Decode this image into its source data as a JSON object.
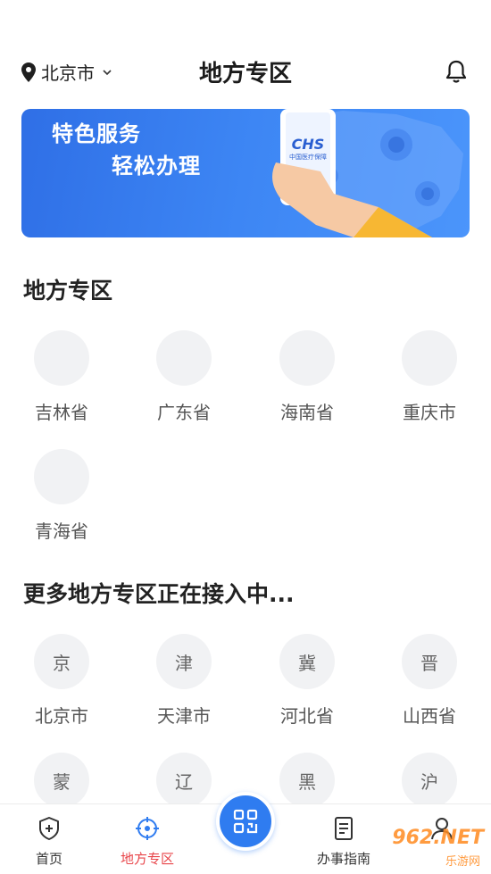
{
  "header": {
    "location": "北京市",
    "title": "地方专区"
  },
  "banner": {
    "line1": "特色服务",
    "line2": "轻松办理",
    "logo_text": "CHS",
    "logo_sub": "中国医疗保障"
  },
  "section_local": {
    "title": "地方专区",
    "items": [
      {
        "label": "吉林省",
        "glyph": ""
      },
      {
        "label": "广东省",
        "glyph": ""
      },
      {
        "label": "海南省",
        "glyph": ""
      },
      {
        "label": "重庆市",
        "glyph": ""
      },
      {
        "label": "青海省",
        "glyph": ""
      }
    ]
  },
  "section_more": {
    "title": "更多地方专区正在接入中...",
    "items": [
      {
        "label": "北京市",
        "glyph": "京"
      },
      {
        "label": "天津市",
        "glyph": "津"
      },
      {
        "label": "河北省",
        "glyph": "冀"
      },
      {
        "label": "山西省",
        "glyph": "晋"
      },
      {
        "label": "",
        "glyph": "蒙"
      },
      {
        "label": "",
        "glyph": "辽"
      },
      {
        "label": "",
        "glyph": "黑"
      },
      {
        "label": "",
        "glyph": "沪"
      }
    ]
  },
  "tabbar": {
    "tabs": [
      {
        "label": "首页",
        "icon": "shield-plus-icon"
      },
      {
        "label": "地方专区",
        "icon": "target-icon"
      },
      {
        "label": "",
        "icon": "qr-scan-icon"
      },
      {
        "label": "办事指南",
        "icon": "document-icon"
      },
      {
        "label": "",
        "icon": "profile-icon"
      }
    ]
  },
  "watermark": {
    "main": "962.NET",
    "sub": "乐游网"
  },
  "colors": {
    "accent": "#2f7cf0",
    "active_tab": "#e8454a",
    "banner": "#3d86f4"
  }
}
